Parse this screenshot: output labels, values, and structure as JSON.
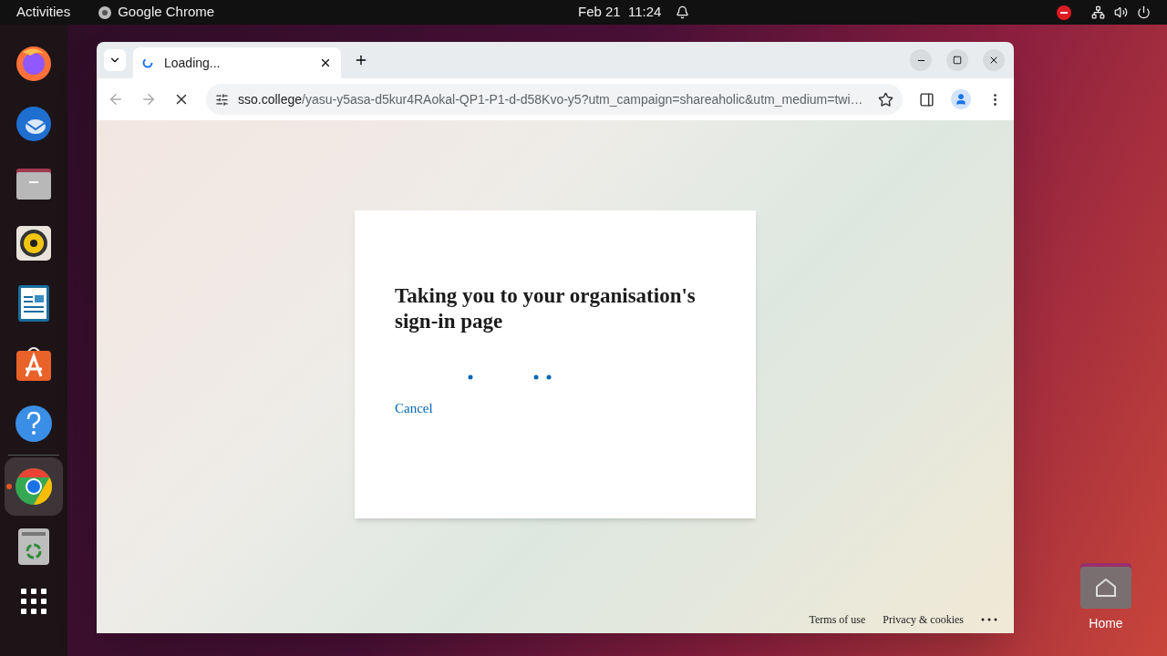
{
  "top_bar": {
    "activities": "Activities",
    "app_name": "Google Chrome",
    "clock": "Feb 21  11:24"
  },
  "dock": {
    "pinned": [
      {
        "kind": "firefox",
        "running": false
      },
      {
        "kind": "thunderbird",
        "running": false
      },
      {
        "kind": "files",
        "running": false
      },
      {
        "kind": "rhythmbox",
        "running": false
      },
      {
        "kind": "writer",
        "running": false
      },
      {
        "kind": "software",
        "running": false
      },
      {
        "kind": "help",
        "running": false
      }
    ],
    "others": [
      {
        "kind": "chrome",
        "running": true
      },
      {
        "kind": "trash",
        "running": false
      }
    ]
  },
  "browser": {
    "tabs": [
      {
        "title": "Loading...",
        "selected": true
      }
    ],
    "loading": true,
    "url": {
      "host": "sso.college",
      "path": "/yasu-y5asa-d5kur4RAokal-QP1-P1-d-d58Kvo-y5?utm_campaign=shareaholic&utm_medium=twi…"
    }
  },
  "page": {
    "heading": "Taking you to your organisation's sign-in page",
    "cancel": "Cancel",
    "footer": [
      "Terms of use",
      "Privacy & cookies"
    ]
  },
  "desktop_icons": [
    {
      "label": "Home"
    }
  ]
}
